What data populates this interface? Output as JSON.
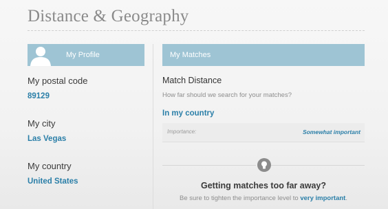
{
  "page": {
    "title": "Distance & Geography"
  },
  "profile": {
    "header": "My Profile",
    "avatar_icon": "person-silhouette-icon",
    "fields": [
      {
        "label": "My postal code",
        "value": "89129"
      },
      {
        "label": "My city",
        "value": "Las Vegas"
      },
      {
        "label": "My country",
        "value": "United States"
      }
    ]
  },
  "matches": {
    "header": "My Matches",
    "title": "Match Distance",
    "question": "How far should we search for your matches?",
    "selected_value": "In my country",
    "importance_label": "Importance:",
    "importance_value": "Somewhat important",
    "tip_icon": "lightbulb-icon",
    "tip_title": "Getting matches too far away?",
    "tip_text_before": "Be sure to tighten the importance level to",
    "tip_link": "very important",
    "tip_text_after": "."
  },
  "colors": {
    "header_bg": "#9ec4d4",
    "accent": "#2b7fa8",
    "title_gray": "#8a8a8a"
  }
}
